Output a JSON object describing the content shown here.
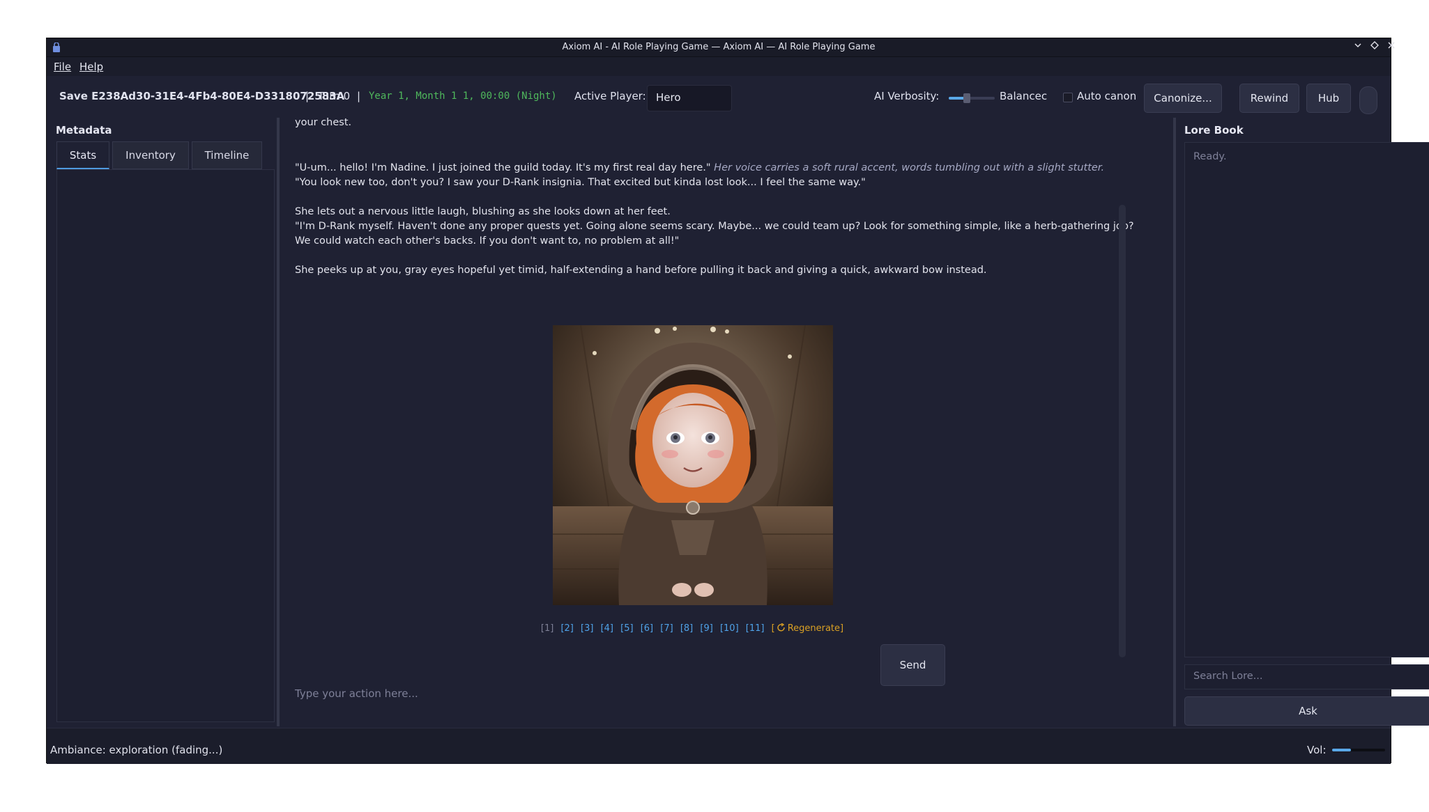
{
  "window": {
    "title": "Axiom AI - AI Role Playing Game — Axiom AI — AI Role Playing Game",
    "controls": [
      "minimize-icon",
      "maximize-icon",
      "close-icon"
    ]
  },
  "menu": {
    "file": "File",
    "help": "Help"
  },
  "toolbar": {
    "save_name": "Save E238Ad30-31E4-4Fb4-80E4-D3318072583A",
    "sep1": "|",
    "turn": "Turn 0",
    "sep2": "|",
    "date": "Year 1, Month 1 1, 00:00 (Night)",
    "active_player_label": "Active Player:",
    "active_player_value": "Hero",
    "verbosity_label": "AI Verbosity:",
    "verbosity_level": 0.4,
    "verbosity_value": "Balancec",
    "auto_canon_label": "Auto canon",
    "auto_canon_checked": false,
    "canonize_label": "Canonize...",
    "rewind_label": "Rewind",
    "hub_label": "Hub"
  },
  "left": {
    "title": "Metadata",
    "tabs": [
      "Stats",
      "Inventory",
      "Timeline"
    ],
    "active_tab": "Stats"
  },
  "chat": {
    "partial_top": "your chest.",
    "para1_speech": "\"U-um... hello! I'm Nadine. I just joined the guild today. It's my first real day here.\"",
    "para1_narr": "Her voice carries a soft rural accent, words tumbling out with a slight stutter.",
    "para1_line2": "\"You look new too, don't you? I saw your D-Rank insignia. That excited but kinda lost look... I feel the same way.\"",
    "para2_narr": "She lets out a nervous little laugh, blushing as she looks down at her feet.",
    "para2_line1": "\"I'm D-Rank myself. Haven't done any proper quests yet. Going alone seems scary. Maybe... we could team up? Look for something simple, like a herb-gathering job?",
    "para2_line2": "We could watch each other's backs. If you don't want to, no problem at all!\"",
    "para3_narr": "She peeks up at you, gray eyes hopeful yet timid, half-extending a hand before pulling it back and giving a quick, awkward bow instead.",
    "pages": [
      "[1]",
      "[2]",
      "[3]",
      "[4]",
      "[5]",
      "[6]",
      "[7]",
      "[8]",
      "[9]",
      "[10]",
      "[11]"
    ],
    "regenerate": "Regenerate]",
    "regenerate_prefix": "[",
    "input_placeholder": "Type your action here...",
    "send_label": "Send"
  },
  "lore": {
    "title": "Lore Book",
    "status": "Ready.",
    "search_placeholder": "Search Lore...",
    "ask_label": "Ask"
  },
  "status": {
    "ambiance": "Ambiance: exploration (fading...)",
    "vol_label": "Vol:",
    "volume": 0.35
  }
}
